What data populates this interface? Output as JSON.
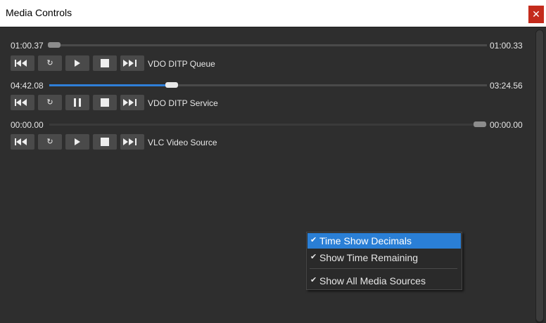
{
  "window": {
    "title": "Media Controls",
    "close_glyph": "✕"
  },
  "sources": [
    {
      "name": "VDO DITP Queue",
      "current_time": "01:00.37",
      "end_time": "01:00.33",
      "progress": 0.0,
      "state": "stopped"
    },
    {
      "name": "VDO DITP Service",
      "current_time": "04:42.08",
      "end_time": "03:24.56",
      "progress": 0.28,
      "state": "playing"
    },
    {
      "name": "VLC Video Source",
      "current_time": "00:00.00",
      "end_time": "00:00.00",
      "progress": 1.0,
      "state": "stopped"
    }
  ],
  "icons": [
    "restart-icon",
    "loop-icon",
    "play-icon",
    "pause-icon",
    "stop-icon",
    "next-icon"
  ],
  "context_menu": {
    "items": [
      {
        "label": "Time Show Decimals",
        "checked": true,
        "highlighted": true
      },
      {
        "label": "Show Time Remaining",
        "checked": true,
        "highlighted": false
      },
      {
        "label": "Show All Media Sources",
        "checked": true,
        "highlighted": false
      }
    ],
    "check_glyph": "✔"
  },
  "colors": {
    "accent": "#2f7fd9",
    "close": "#c42b1c",
    "background": "#2e2e2e"
  }
}
